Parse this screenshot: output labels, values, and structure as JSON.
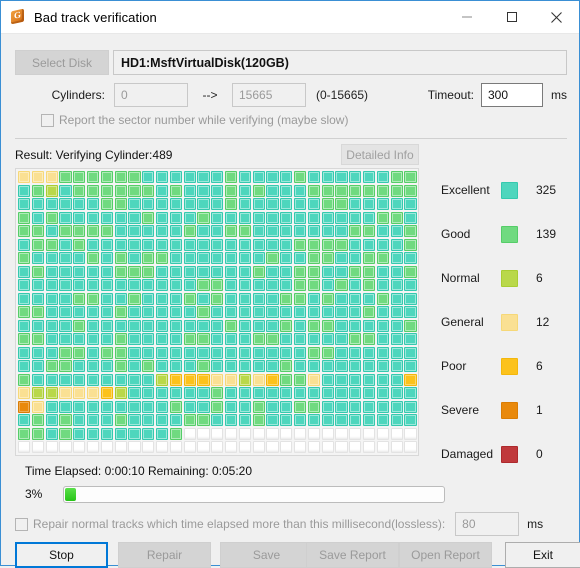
{
  "window": {
    "title": "Bad track verification",
    "icon": "app-logo-icon",
    "minimize": "minimize-icon",
    "maximize": "maximize-icon",
    "close": "close-icon"
  },
  "disk": {
    "select_button": "Select Disk",
    "selected": "HD1:MsftVirtualDisk(120GB)"
  },
  "cylinders": {
    "label": "Cylinders:",
    "from": "0",
    "arrow": "-->",
    "to": "15665",
    "range": "(0-15665)"
  },
  "timeout": {
    "label": "Timeout:",
    "value": "300",
    "unit": "ms"
  },
  "report_sector": {
    "label": "Report the sector number while verifying (maybe slow)",
    "checked": false
  },
  "result": {
    "label": "Result:  Verifying Cylinder:489",
    "detailed_info_button": "Detailed Info"
  },
  "legend": [
    {
      "name": "Excellent",
      "count": "325",
      "color": "#4ed6bd",
      "class": "sw1"
    },
    {
      "name": "Good",
      "count": "139",
      "color": "#70da80",
      "class": "sw2"
    },
    {
      "name": "Normal",
      "count": "6",
      "color": "#b9d84a",
      "class": "sw3"
    },
    {
      "name": "General",
      "count": "12",
      "color": "#fae093",
      "class": "sw4"
    },
    {
      "name": "Poor",
      "count": "6",
      "color": "#fcc21c",
      "class": "sw5"
    },
    {
      "name": "Severe",
      "count": "1",
      "color": "#e9890c",
      "class": "sw6"
    },
    {
      "name": "Damaged",
      "count": "0",
      "color": "#c0393c",
      "class": "sw7"
    }
  ],
  "grid": {
    "columns": 29,
    "rows": 21,
    "legend_index_map": {
      "0": "empty",
      "1": "Excellent",
      "2": "Good",
      "3": "Normal",
      "4": "General",
      "5": "Poor",
      "6": "Severe",
      "7": "Damaged"
    },
    "cells": [
      [
        4,
        4,
        4,
        2,
        2,
        2,
        2,
        2,
        2,
        1,
        1,
        1,
        1,
        1,
        1,
        2,
        1,
        1,
        1,
        1,
        2,
        1,
        1,
        1,
        1,
        1,
        1,
        2,
        2
      ],
      [
        1,
        2,
        3,
        1,
        2,
        2,
        2,
        2,
        2,
        2,
        1,
        2,
        1,
        1,
        1,
        2,
        1,
        2,
        1,
        1,
        1,
        2,
        2,
        2,
        2,
        2,
        2,
        2,
        2
      ],
      [
        1,
        1,
        1,
        1,
        1,
        1,
        2,
        2,
        1,
        1,
        1,
        1,
        1,
        1,
        1,
        2,
        1,
        1,
        1,
        1,
        1,
        1,
        2,
        2,
        1,
        1,
        1,
        1,
        1
      ],
      [
        2,
        1,
        2,
        1,
        1,
        1,
        1,
        1,
        1,
        2,
        1,
        1,
        1,
        2,
        1,
        1,
        1,
        1,
        1,
        1,
        1,
        1,
        1,
        1,
        1,
        1,
        2,
        2,
        1
      ],
      [
        2,
        2,
        1,
        2,
        2,
        2,
        2,
        1,
        1,
        1,
        1,
        1,
        2,
        1,
        1,
        2,
        2,
        1,
        1,
        1,
        1,
        1,
        1,
        1,
        2,
        2,
        1,
        1,
        2
      ],
      [
        1,
        2,
        2,
        1,
        2,
        1,
        1,
        1,
        1,
        1,
        1,
        1,
        1,
        1,
        1,
        1,
        1,
        1,
        1,
        1,
        2,
        2,
        2,
        2,
        1,
        1,
        1,
        1,
        2
      ],
      [
        2,
        1,
        1,
        1,
        1,
        2,
        1,
        2,
        1,
        2,
        2,
        1,
        1,
        1,
        1,
        1,
        1,
        1,
        2,
        1,
        1,
        2,
        2,
        1,
        1,
        2,
        2,
        1,
        1
      ],
      [
        1,
        2,
        1,
        1,
        1,
        1,
        1,
        2,
        2,
        2,
        1,
        1,
        1,
        1,
        1,
        1,
        1,
        2,
        1,
        1,
        2,
        2,
        1,
        1,
        2,
        2,
        1,
        1,
        2
      ],
      [
        1,
        1,
        1,
        1,
        1,
        1,
        1,
        1,
        1,
        1,
        1,
        1,
        1,
        2,
        2,
        1,
        1,
        1,
        1,
        1,
        2,
        2,
        1,
        2,
        1,
        2,
        1,
        1,
        1
      ],
      [
        1,
        1,
        1,
        1,
        2,
        2,
        1,
        1,
        2,
        1,
        1,
        1,
        2,
        1,
        2,
        1,
        1,
        1,
        1,
        2,
        2,
        1,
        2,
        1,
        1,
        1,
        2,
        1,
        1
      ],
      [
        2,
        2,
        1,
        1,
        1,
        1,
        1,
        2,
        1,
        1,
        1,
        1,
        1,
        2,
        1,
        1,
        1,
        1,
        1,
        1,
        1,
        1,
        1,
        1,
        1,
        2,
        1,
        1,
        1
      ],
      [
        1,
        1,
        1,
        1,
        2,
        1,
        1,
        1,
        1,
        1,
        1,
        1,
        1,
        1,
        1,
        2,
        1,
        1,
        1,
        2,
        1,
        2,
        2,
        1,
        1,
        1,
        1,
        1,
        2
      ],
      [
        2,
        2,
        1,
        1,
        1,
        1,
        1,
        2,
        1,
        1,
        1,
        1,
        2,
        2,
        1,
        1,
        1,
        2,
        2,
        1,
        1,
        1,
        1,
        1,
        2,
        2,
        1,
        1,
        1
      ],
      [
        1,
        1,
        1,
        2,
        2,
        1,
        2,
        2,
        1,
        1,
        1,
        1,
        1,
        1,
        1,
        1,
        1,
        1,
        1,
        1,
        1,
        2,
        2,
        1,
        1,
        1,
        1,
        1,
        1
      ],
      [
        1,
        1,
        2,
        2,
        1,
        1,
        1,
        2,
        1,
        2,
        1,
        1,
        1,
        2,
        1,
        1,
        1,
        1,
        1,
        2,
        1,
        1,
        1,
        1,
        1,
        1,
        1,
        1,
        1
      ],
      [
        2,
        1,
        1,
        1,
        1,
        1,
        1,
        1,
        1,
        1,
        3,
        5,
        5,
        5,
        4,
        4,
        3,
        4,
        5,
        2,
        2,
        4,
        1,
        1,
        1,
        1,
        1,
        1,
        5
      ],
      [
        4,
        3,
        3,
        4,
        4,
        4,
        5,
        3,
        1,
        1,
        1,
        1,
        1,
        1,
        2,
        1,
        1,
        1,
        1,
        1,
        1,
        1,
        1,
        1,
        1,
        1,
        1,
        1,
        1
      ],
      [
        6,
        4,
        1,
        1,
        1,
        1,
        1,
        1,
        1,
        1,
        1,
        2,
        1,
        1,
        2,
        1,
        1,
        2,
        1,
        1,
        2,
        2,
        1,
        1,
        1,
        1,
        1,
        1,
        1
      ],
      [
        1,
        2,
        1,
        2,
        1,
        1,
        1,
        2,
        1,
        1,
        1,
        1,
        2,
        2,
        1,
        1,
        1,
        2,
        1,
        1,
        1,
        1,
        1,
        1,
        1,
        1,
        1,
        1,
        1
      ],
      [
        2,
        2,
        1,
        2,
        1,
        1,
        1,
        1,
        1,
        1,
        1,
        2,
        0,
        0,
        0,
        0,
        0,
        0,
        0,
        0,
        0,
        0,
        0,
        0,
        0,
        0,
        0,
        0,
        0
      ],
      [
        0,
        0,
        0,
        0,
        0,
        0,
        0,
        0,
        0,
        0,
        0,
        0,
        0,
        0,
        0,
        0,
        0,
        0,
        0,
        0,
        0,
        0,
        0,
        0,
        0,
        0,
        0,
        0,
        0
      ]
    ]
  },
  "progress": {
    "time_text": "Time Elapsed:  0:00:10  Remaining:  0:05:20",
    "percent_label": "3%",
    "percent_value": 3
  },
  "repair_option": {
    "label": "Repair normal tracks which time elapsed more than this millisecond(lossless):",
    "value": "80",
    "unit": "ms",
    "checked": false
  },
  "buttons": {
    "stop": "Stop",
    "repair": "Repair",
    "save": "Save",
    "save_report": "Save Report",
    "open_report": "Open Report",
    "exit": "Exit"
  }
}
